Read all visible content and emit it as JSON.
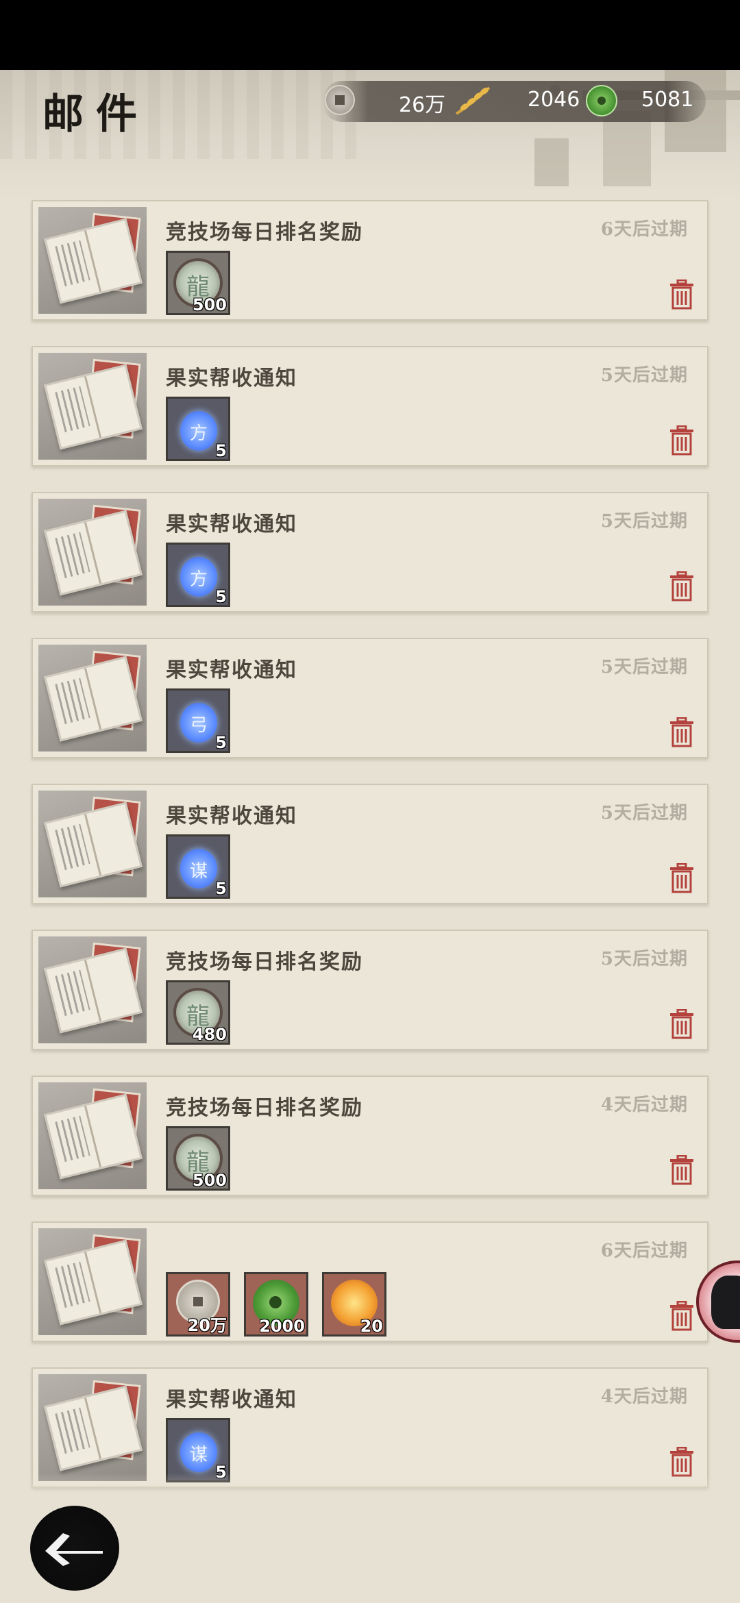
{
  "header": {
    "title": "邮件",
    "currencies": {
      "coins": "26万",
      "grain": "2046",
      "jade": "5081"
    }
  },
  "mails": [
    {
      "title": "竞技场每日排名奖励",
      "expiry": "6天后过期",
      "items": [
        {
          "type": "dragon",
          "icon": "dragon-medal-icon",
          "count": "500"
        }
      ]
    },
    {
      "title": "果实帮收通知",
      "expiry": "5天后过期",
      "items": [
        {
          "type": "bag",
          "icon": "fruit-bag-icon",
          "glyph": "方",
          "count": "5"
        }
      ]
    },
    {
      "title": "果实帮收通知",
      "expiry": "5天后过期",
      "items": [
        {
          "type": "bag",
          "icon": "fruit-bag-icon",
          "glyph": "方",
          "count": "5"
        }
      ]
    },
    {
      "title": "果实帮收通知",
      "expiry": "5天后过期",
      "items": [
        {
          "type": "bag",
          "icon": "fruit-bag-icon",
          "glyph": "弓",
          "count": "5"
        }
      ]
    },
    {
      "title": "果实帮收通知",
      "expiry": "5天后过期",
      "items": [
        {
          "type": "bag",
          "icon": "fruit-bag-icon",
          "glyph": "谋",
          "count": "5"
        }
      ]
    },
    {
      "title": "竞技场每日排名奖励",
      "expiry": "5天后过期",
      "items": [
        {
          "type": "dragon",
          "icon": "dragon-medal-icon",
          "count": "480"
        }
      ]
    },
    {
      "title": "竞技场每日排名奖励",
      "expiry": "4天后过期",
      "items": [
        {
          "type": "dragon",
          "icon": "dragon-medal-icon",
          "count": "500"
        }
      ]
    },
    {
      "title": "",
      "expiry": "6天后过期",
      "items": [
        {
          "type": "coin",
          "icon": "copper-coin-icon",
          "count": "20万"
        },
        {
          "type": "jade",
          "icon": "jade-coin-icon",
          "count": "2000"
        },
        {
          "type": "fire",
          "icon": "fire-orb-icon",
          "count": "20"
        }
      ]
    },
    {
      "title": "果实帮收通知",
      "expiry": "4天后过期",
      "items": [
        {
          "type": "bag",
          "icon": "fruit-bag-icon",
          "glyph": "谋",
          "count": "5"
        }
      ]
    }
  ],
  "colors": {
    "background": "#e6e1d3",
    "card": "#ebe6d8",
    "trash_red": "#b3423c",
    "expiry_text": "#b3ada1"
  }
}
